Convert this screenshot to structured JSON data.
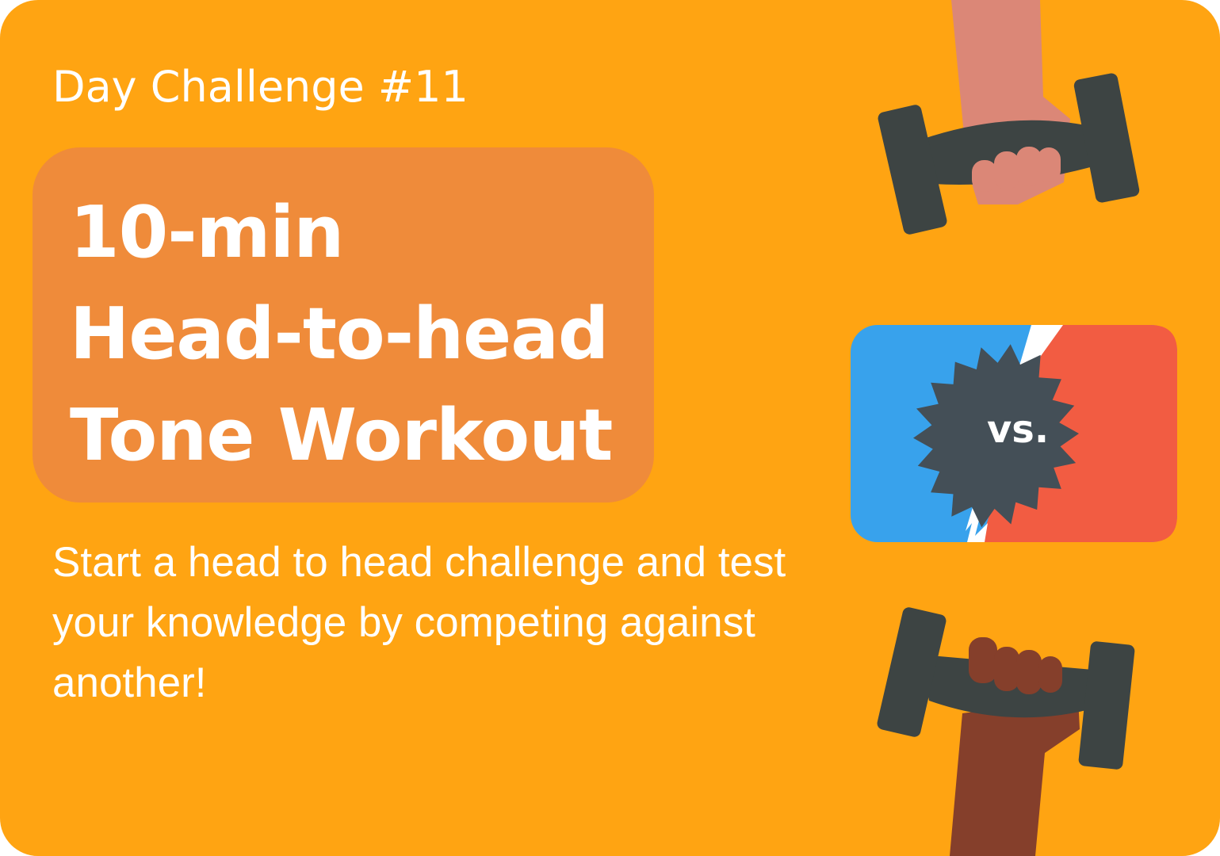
{
  "card": {
    "kicker": "Day Challenge #11",
    "title_lines": [
      "10-min",
      "Head-to-head",
      "Tone Workout"
    ],
    "description": "Start a head to head challenge and test your knowledge by competing against another!",
    "badge_text": "vs."
  },
  "colors": {
    "background": "#FFA412",
    "title_box": "#EF8B3A",
    "blue": "#38A2EC",
    "red": "#F25C42",
    "badge": "#444F57",
    "dumbbell": "#3D4443",
    "skin_light": "#DB8777",
    "skin_dark": "#853F2B",
    "text": "#FFFFFF"
  },
  "icons": {
    "top": "dumbbell-light-hand-icon",
    "center": "versus-icon",
    "bottom": "dumbbell-dark-hand-icon"
  }
}
